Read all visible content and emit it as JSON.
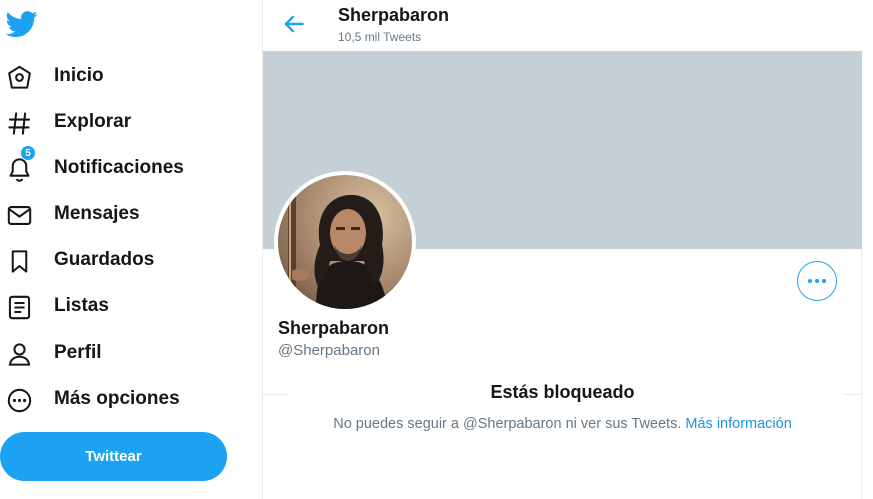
{
  "sidebar": {
    "logo_icon": "twitter-bird-icon",
    "items": [
      {
        "label": "Inicio",
        "icon": "home-icon"
      },
      {
        "label": "Explorar",
        "icon": "hashtag-icon"
      },
      {
        "label": "Notificaciones",
        "icon": "bell-icon",
        "badge": "5"
      },
      {
        "label": "Mensajes",
        "icon": "mail-icon"
      },
      {
        "label": "Guardados",
        "icon": "bookmark-icon"
      },
      {
        "label": "Listas",
        "icon": "list-icon"
      },
      {
        "label": "Perfil",
        "icon": "person-icon"
      },
      {
        "label": "Más opciones",
        "icon": "more-circle-icon"
      }
    ],
    "tweet_button": "Twittear"
  },
  "header": {
    "name": "Sherpabaron",
    "tweet_count": "10,5 mil Tweets"
  },
  "profile": {
    "name": "Sherpabaron",
    "handle": "@Sherpabaron"
  },
  "blocked": {
    "title": "Estás bloqueado",
    "message": "No puedes seguir a @Sherpabaron ni ver sus Tweets. ",
    "link": "Más información"
  },
  "colors": {
    "accent": "#1da1f2",
    "banner": "#c4cfd6",
    "secondary_text": "#657786"
  }
}
